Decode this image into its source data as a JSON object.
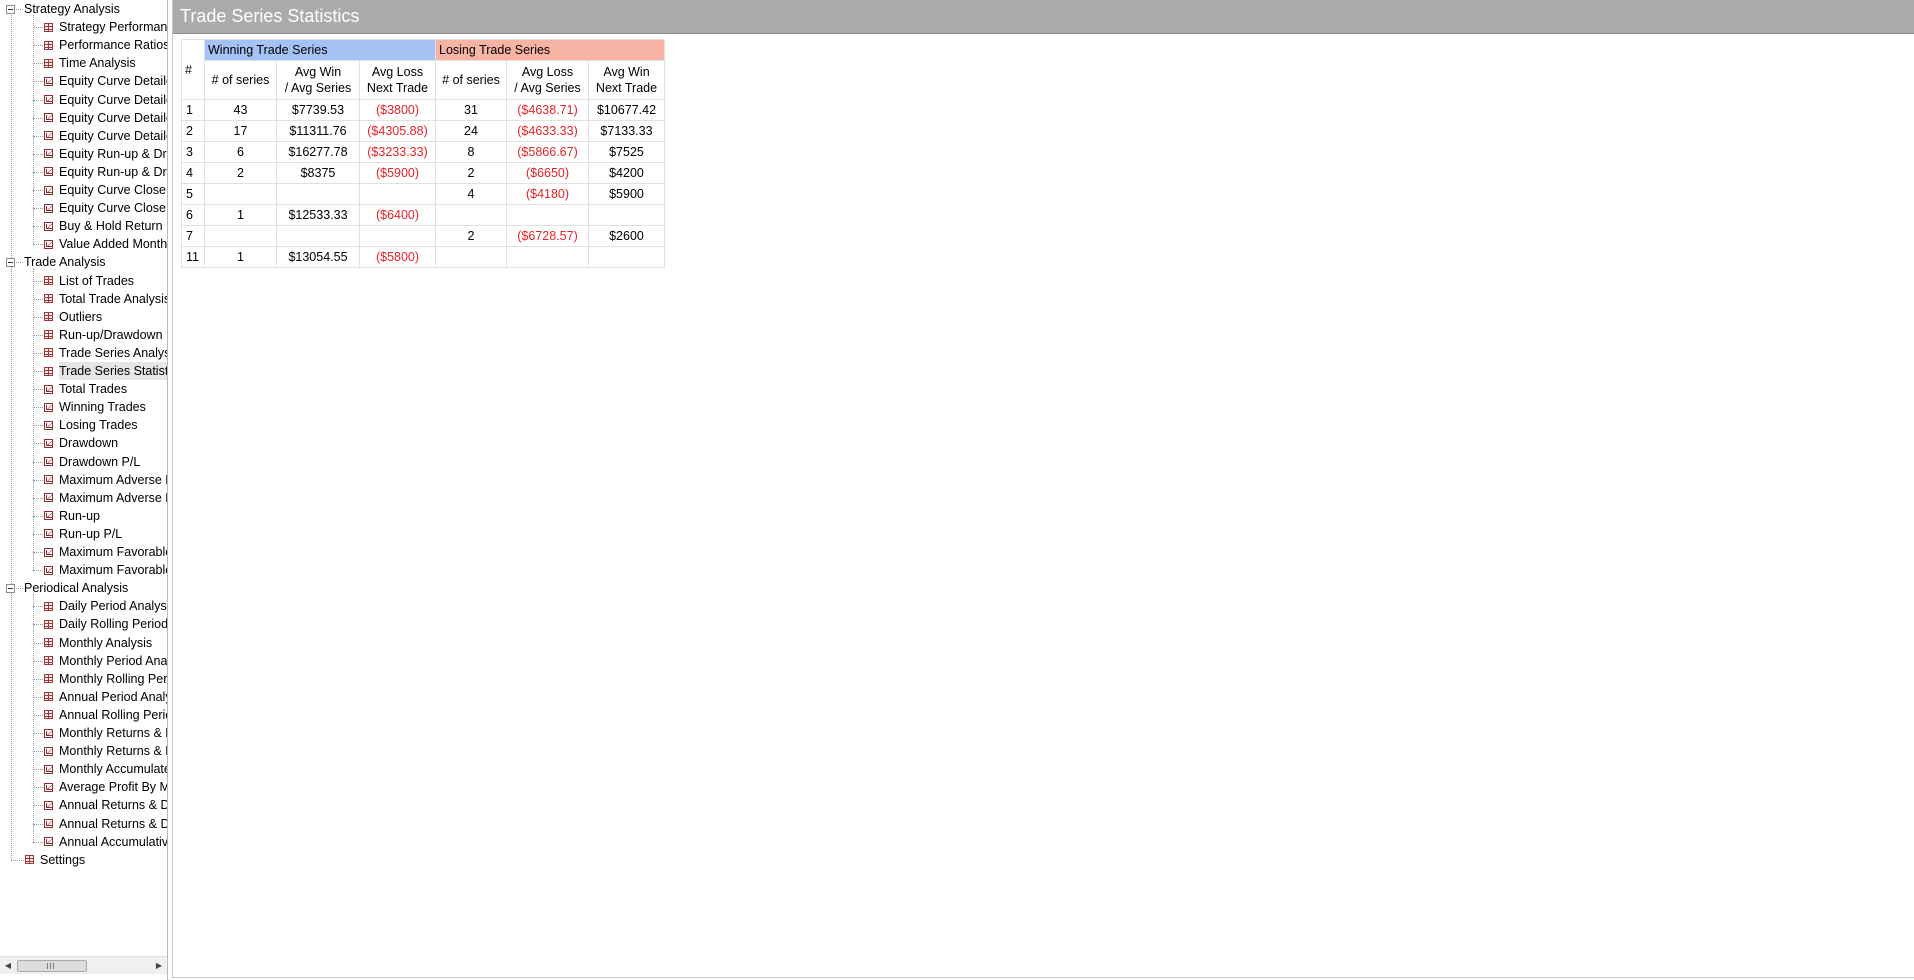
{
  "colors": {
    "title_bar_bg": "#ababab",
    "winning_header_bg": "#a4c2f4",
    "losing_header_bg": "#f7b3a3",
    "negative_text": "#e0252b",
    "selected_row_bg": "#e6e6e6"
  },
  "nav": {
    "groups": [
      {
        "label": "Strategy Analysis",
        "items": [
          {
            "label": "Strategy Performance Report",
            "icon": "table-icon"
          },
          {
            "label": "Performance Ratios",
            "icon": "table-icon"
          },
          {
            "label": "Time Analysis",
            "icon": "table-icon"
          },
          {
            "label": "Equity Curve Detailed",
            "icon": "chart-icon"
          },
          {
            "label": "Equity Curve Detailed",
            "icon": "chart-icon"
          },
          {
            "label": "Equity Curve Detailed",
            "icon": "chart-icon"
          },
          {
            "label": "Equity Curve Detailed",
            "icon": "chart-icon"
          },
          {
            "label": "Equity Run-up & Drawdown",
            "icon": "chart-icon"
          },
          {
            "label": "Equity Run-up & Drawdown",
            "icon": "chart-icon"
          },
          {
            "label": "Equity Curve Close To Close",
            "icon": "chart-icon"
          },
          {
            "label": "Equity Curve Close To Close",
            "icon": "chart-icon"
          },
          {
            "label": "Buy & Hold Return",
            "icon": "chart-icon"
          },
          {
            "label": "Value Added Monthly",
            "icon": "chart-icon"
          }
        ]
      },
      {
        "label": "Trade Analysis",
        "items": [
          {
            "label": "List of Trades",
            "icon": "table-icon"
          },
          {
            "label": "Total Trade Analysis",
            "icon": "table-icon"
          },
          {
            "label": "Outliers",
            "icon": "table-icon"
          },
          {
            "label": "Run-up/Drawdown",
            "icon": "table-icon"
          },
          {
            "label": "Trade Series Analysis",
            "icon": "table-icon"
          },
          {
            "label": "Trade Series Statistics",
            "icon": "table-icon",
            "selected": true
          },
          {
            "label": "Total Trades",
            "icon": "chart-icon"
          },
          {
            "label": "Winning Trades",
            "icon": "chart-icon"
          },
          {
            "label": "Losing Trades",
            "icon": "chart-icon"
          },
          {
            "label": "Drawdown",
            "icon": "chart-icon"
          },
          {
            "label": "Drawdown P/L",
            "icon": "chart-icon"
          },
          {
            "label": "Maximum Adverse Excursion",
            "icon": "chart-icon"
          },
          {
            "label": "Maximum Adverse Excursion",
            "icon": "chart-icon"
          },
          {
            "label": "Run-up",
            "icon": "chart-icon"
          },
          {
            "label": "Run-up P/L",
            "icon": "chart-icon"
          },
          {
            "label": "Maximum Favorable Excursion",
            "icon": "chart-icon"
          },
          {
            "label": "Maximum Favorable Excursion",
            "icon": "chart-icon"
          }
        ]
      },
      {
        "label": "Periodical Analysis",
        "items": [
          {
            "label": "Daily Period Analysis",
            "icon": "table-icon"
          },
          {
            "label": "Daily Rolling Period Analysis",
            "icon": "table-icon"
          },
          {
            "label": "Monthly Analysis",
            "icon": "table-icon"
          },
          {
            "label": "Monthly Period Analysis",
            "icon": "table-icon"
          },
          {
            "label": "Monthly Rolling Period Analysis",
            "icon": "table-icon"
          },
          {
            "label": "Annual Period Analysis",
            "icon": "table-icon"
          },
          {
            "label": "Annual Rolling Period Analysis",
            "icon": "table-icon"
          },
          {
            "label": "Monthly Returns & Drawdown",
            "icon": "chart-icon"
          },
          {
            "label": "Monthly Returns & Drawdown",
            "icon": "chart-icon"
          },
          {
            "label": "Monthly Accumulated Returns",
            "icon": "chart-icon"
          },
          {
            "label": "Average Profit By Month",
            "icon": "chart-icon"
          },
          {
            "label": "Annual Returns & Drawdown",
            "icon": "chart-icon"
          },
          {
            "label": "Annual Returns & Drawdown",
            "icon": "chart-icon"
          },
          {
            "label": "Annual Accumulative Returns",
            "icon": "chart-icon"
          }
        ]
      }
    ],
    "settings": {
      "label": "Settings",
      "icon": "table-icon"
    },
    "scrollbar": {
      "left_arrow": "◀",
      "right_arrow": "▶"
    }
  },
  "page": {
    "title": "Trade Series Statistics"
  },
  "table": {
    "hash": "#",
    "winning_title": "Winning Trade Series",
    "losing_title": "Losing Trade Series",
    "winning_columns": [
      {
        "line1": "# of series",
        "line2": ""
      },
      {
        "line1": "Avg Win",
        "line2": "/ Avg Series"
      },
      {
        "line1": "Avg Loss",
        "line2": "Next Trade"
      }
    ],
    "losing_columns": [
      {
        "line1": "# of series",
        "line2": ""
      },
      {
        "line1": "Avg Loss",
        "line2": "/ Avg Series"
      },
      {
        "line1": "Avg Win",
        "line2": "Next Trade"
      }
    ],
    "rows": [
      {
        "n": "1",
        "w_count": "43",
        "w_avg": "$7739.53",
        "w_next": "($3800)",
        "l_count": "31",
        "l_avg": "($4638.71)",
        "l_next": "$10677.42"
      },
      {
        "n": "2",
        "w_count": "17",
        "w_avg": "$11311.76",
        "w_next": "($4305.88)",
        "l_count": "24",
        "l_avg": "($4633.33)",
        "l_next": "$7133.33"
      },
      {
        "n": "3",
        "w_count": "6",
        "w_avg": "$16277.78",
        "w_next": "($3233.33)",
        "l_count": "8",
        "l_avg": "($5866.67)",
        "l_next": "$7525"
      },
      {
        "n": "4",
        "w_count": "2",
        "w_avg": "$8375",
        "w_next": "($5900)",
        "l_count": "2",
        "l_avg": "($6650)",
        "l_next": "$4200"
      },
      {
        "n": "5",
        "w_count": "",
        "w_avg": "",
        "w_next": "",
        "l_count": "4",
        "l_avg": "($4180)",
        "l_next": "$5900"
      },
      {
        "n": "6",
        "w_count": "1",
        "w_avg": "$12533.33",
        "w_next": "($6400)",
        "l_count": "",
        "l_avg": "",
        "l_next": ""
      },
      {
        "n": "7",
        "w_count": "",
        "w_avg": "",
        "w_next": "",
        "l_count": "2",
        "l_avg": "($6728.57)",
        "l_next": "$2600"
      },
      {
        "n": "11",
        "w_count": "1",
        "w_avg": "$13054.55",
        "w_next": "($5800)",
        "l_count": "",
        "l_avg": "",
        "l_next": ""
      }
    ]
  }
}
